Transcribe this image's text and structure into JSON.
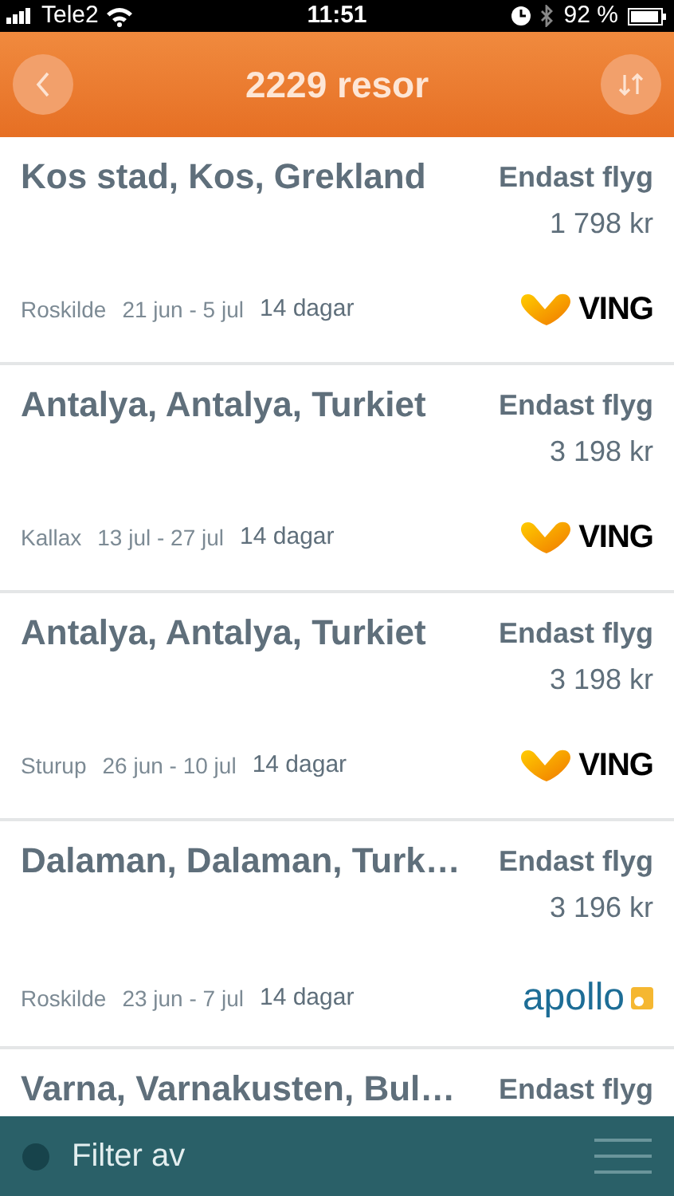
{
  "status_bar": {
    "carrier": "Tele2",
    "time": "11:51",
    "battery": "92 %"
  },
  "header": {
    "title": "2229 resor"
  },
  "trips": [
    {
      "title": "Kos stad, Kos, Grekland",
      "tag": "Endast flyg",
      "price": "1 798 kr",
      "from": "Roskilde",
      "dates": "21 jun - 5 jul",
      "duration": "14 dagar",
      "brand": {
        "kind": "ving",
        "text": "VING"
      }
    },
    {
      "title": "Antalya, Antalya, Turkiet",
      "tag": "Endast flyg",
      "price": "3 198 kr",
      "from": "Kallax",
      "dates": "13 jul - 27 jul",
      "duration": "14 dagar",
      "brand": {
        "kind": "ving",
        "text": "VING"
      }
    },
    {
      "title": "Antalya, Antalya, Turkiet",
      "tag": "Endast flyg",
      "price": "3 198 kr",
      "from": "Sturup",
      "dates": "26 jun - 10 jul",
      "duration": "14 dagar",
      "brand": {
        "kind": "ving",
        "text": "VING"
      }
    },
    {
      "title": "Dalaman, Dalaman, Turk…",
      "tag": "Endast flyg",
      "price": "3 196 kr",
      "from": "Roskilde",
      "dates": "23 jun - 7 jul",
      "duration": "14 dagar",
      "brand": {
        "kind": "apollo",
        "text": "apollo"
      }
    },
    {
      "title": "Varna, Varnakusten, Bul…",
      "tag": "Endast flyg"
    }
  ],
  "footer": {
    "label": "Filter av"
  }
}
